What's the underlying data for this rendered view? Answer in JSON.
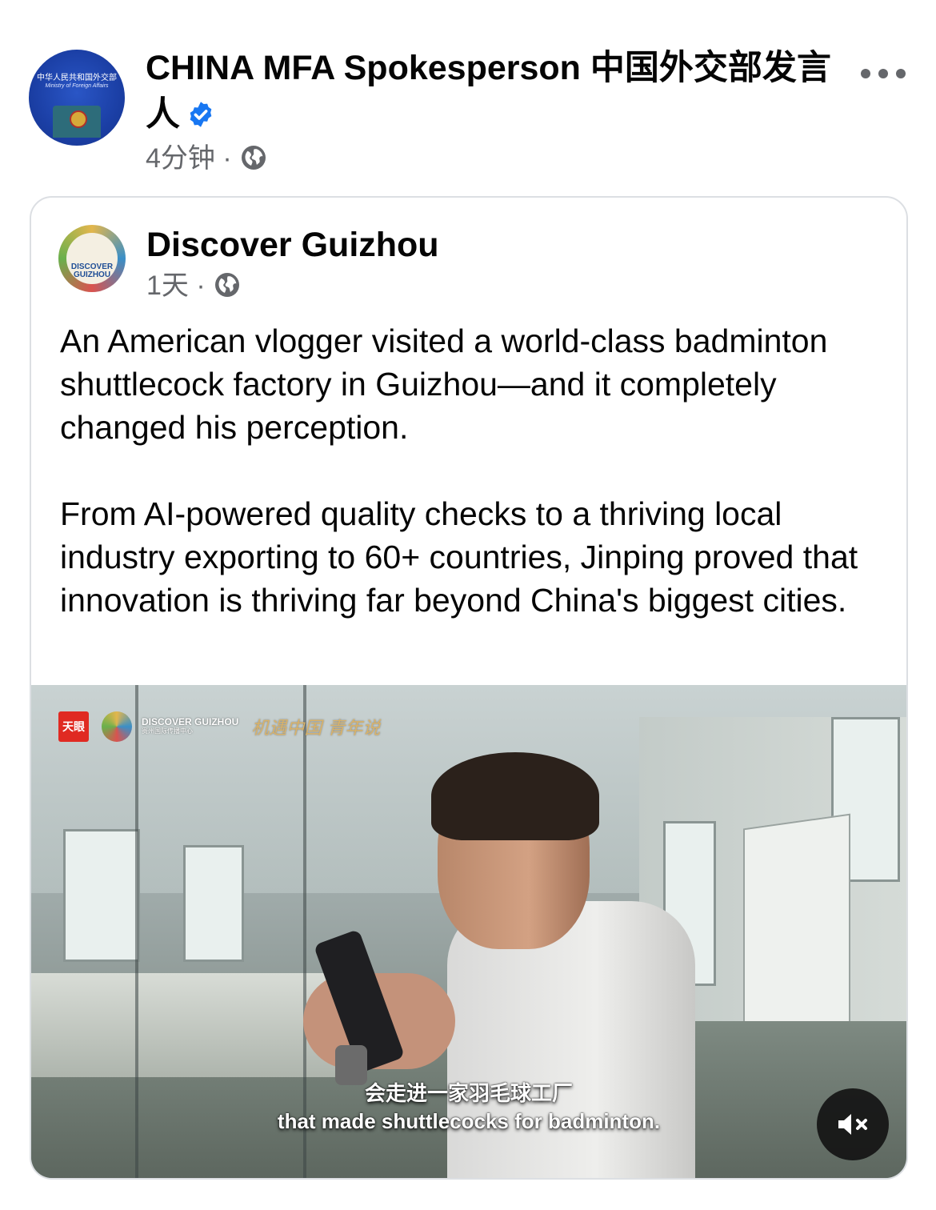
{
  "post": {
    "author": "CHINA MFA Spokesperson 中国外交部发言人",
    "timestamp": "4分钟",
    "separator": "·",
    "avatar_text": "中华人民共和国外交部",
    "avatar_subtext": "Ministry of Foreign Affairs",
    "verified_icon": "verified-badge-icon",
    "audience_icon": "globe-icon",
    "more_icon": "more-options-icon"
  },
  "shared": {
    "author": "Discover Guizhou",
    "avatar_text": "DISCOVER GUIZHOU",
    "timestamp": "1天",
    "separator": "·",
    "audience_icon": "globe-icon",
    "paragraphs": [
      "An American vlogger visited a world-class badminton shuttlecock factory in Guizhou—and it completely changed his perception.",
      "From AI-powered quality checks to a thriving local industry exporting to 60+ countries, Jinping proved that innovation is thriving far beyond China's biggest cities."
    ]
  },
  "video": {
    "logo_tianyan": "天眼",
    "logo_discover": "DISCOVER GUIZHOU",
    "logo_discover_sub": "贵州国际传播中心",
    "logo_script": "机遇中国 青年说",
    "subtitle_zh": "会走进一家羽毛球工厂",
    "subtitle_en": "that made shuttlecocks for badminton.",
    "mute_icon": "speaker-muted-icon"
  },
  "colors": {
    "text_primary": "#050505",
    "text_secondary": "#65676b",
    "verified_blue": "#1877f2",
    "card_border": "#dcdfe3"
  }
}
